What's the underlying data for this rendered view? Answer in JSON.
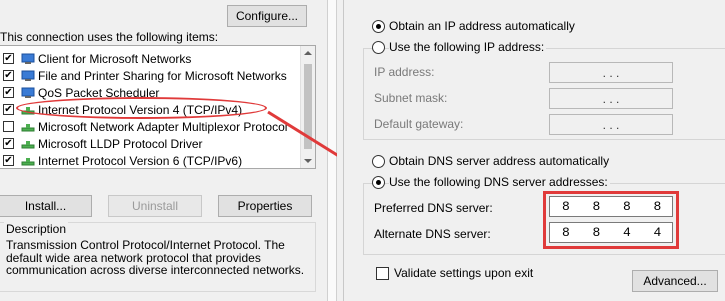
{
  "left": {
    "configure_label": "Configure...",
    "items_heading": "This connection uses the following items:",
    "items": [
      {
        "label": "Client for Microsoft Networks",
        "checked": true,
        "icon": "network-client-icon"
      },
      {
        "label": "File and Printer Sharing for Microsoft Networks",
        "checked": true,
        "icon": "file-sharing-icon"
      },
      {
        "label": "QoS Packet Scheduler",
        "checked": true,
        "icon": "qos-scheduler-icon"
      },
      {
        "label": "Internet Protocol Version 4 (TCP/IPv4)",
        "checked": true,
        "icon": "protocol-icon"
      },
      {
        "label": "Microsoft Network Adapter Multiplexor Protocol",
        "checked": false,
        "icon": "protocol-icon"
      },
      {
        "label": "Microsoft LLDP Protocol Driver",
        "checked": true,
        "icon": "protocol-icon"
      },
      {
        "label": "Internet Protocol Version 6 (TCP/IPv6)",
        "checked": true,
        "icon": "protocol-icon"
      }
    ],
    "install_label": "Install...",
    "uninstall_label": "Uninstall",
    "properties_label": "Properties",
    "description_heading": "Description",
    "description_text": "Transmission Control Protocol/Internet Protocol. The default wide area network protocol that provides communication across diverse interconnected networks."
  },
  "right": {
    "obtain_ip_auto": "Obtain an IP address automatically",
    "use_following_ip": "Use the following IP address:",
    "ip_address_label": "IP address:",
    "subnet_mask_label": "Subnet mask:",
    "default_gateway_label": "Default gateway:",
    "ip_dots": ". . .",
    "obtain_dns_auto": "Obtain DNS server address automatically",
    "use_following_dns": "Use the following DNS server addresses:",
    "preferred_dns_label": "Preferred DNS server:",
    "alternate_dns_label": "Alternate DNS server:",
    "preferred_dns_octets": [
      "8",
      "8",
      "8",
      "8"
    ],
    "alternate_dns_octets": [
      "8",
      "8",
      "4",
      "4"
    ],
    "validate_label": "Validate settings upon exit",
    "advanced_label": "Advanced..."
  },
  "colors": {
    "annotation": "#e03a3a"
  }
}
